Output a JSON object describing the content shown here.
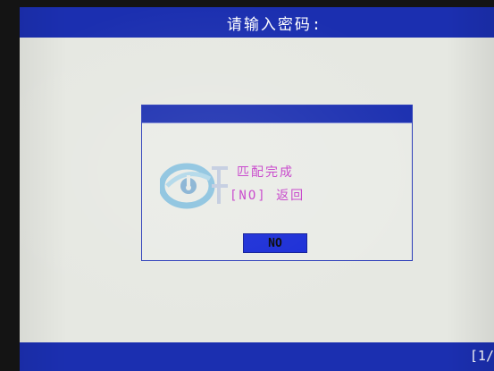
{
  "header": {
    "title": "请输入密码:"
  },
  "dialog": {
    "message_line_1": "匹配完成",
    "message_line_2": "[NO] 返回",
    "no_button_label": "NO"
  },
  "footer": {
    "page_indicator": "[1/"
  },
  "watermark": {
    "icon": "watermark-logo-icon"
  },
  "colors": {
    "bar_blue": "#1b2fb0",
    "button_blue": "#1528d6",
    "screen_bg": "#e6e8e2",
    "message_text": "#c43ac8"
  }
}
